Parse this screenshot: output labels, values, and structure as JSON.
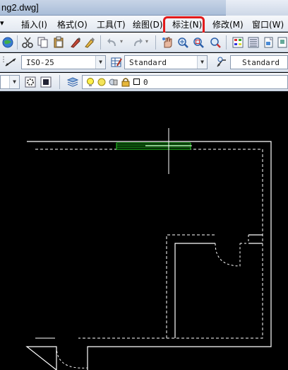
{
  "window": {
    "title": "ng2.dwg]"
  },
  "menubar": {
    "items": [
      {
        "label": "插入(I)"
      },
      {
        "label": "格式(O)"
      },
      {
        "label": "工具(T)"
      },
      {
        "label": "绘图(D)"
      },
      {
        "label": "标注(N)"
      },
      {
        "label": "修改(M)"
      },
      {
        "label": "窗口(W)"
      }
    ],
    "highlight_color": "#e21b1b"
  },
  "toolbar": {
    "dim_style": "ISO-25",
    "text_style": "Standard",
    "table_style": "Standard",
    "layer_name": "0"
  },
  "canvas": {
    "background": "#000000",
    "wall_color": "#ffffff",
    "window_color": "#21d321"
  }
}
